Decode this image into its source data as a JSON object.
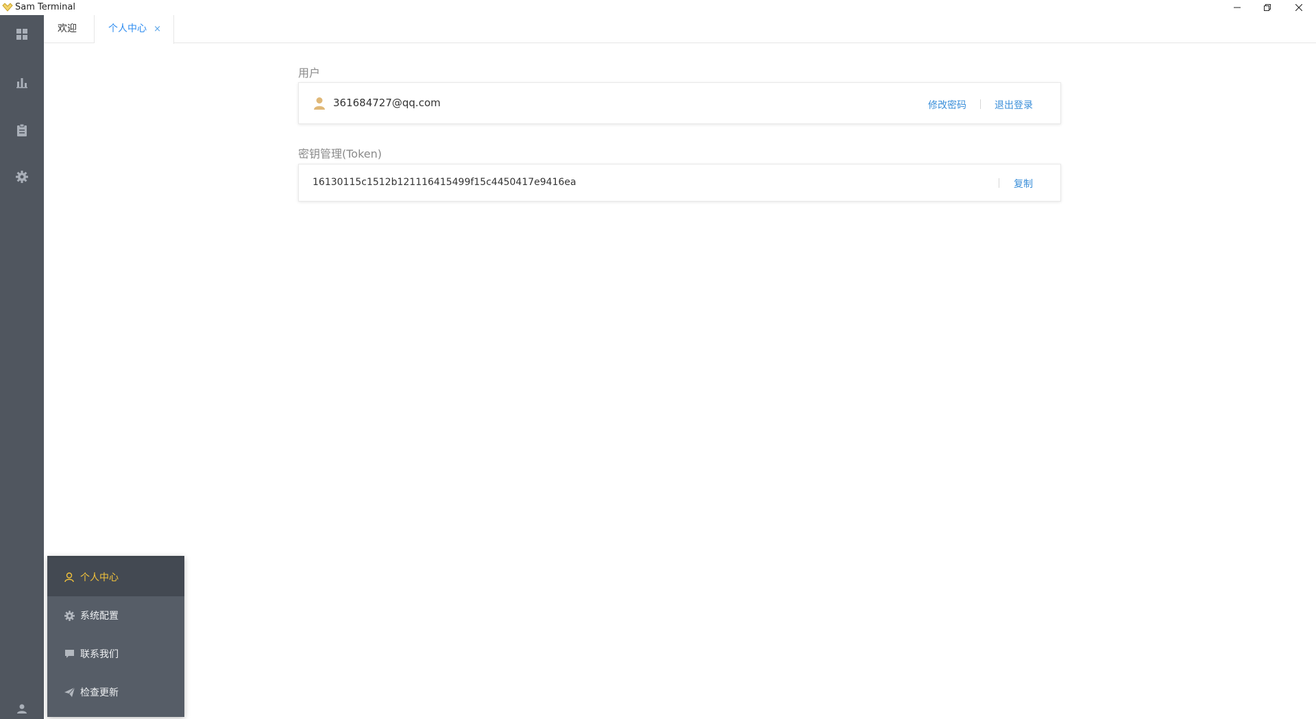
{
  "window": {
    "title": "Sam Terminal"
  },
  "tabs": {
    "welcome": "欢迎",
    "profile": "个人中心",
    "close_glyph": "×"
  },
  "user_section": {
    "label": "用户",
    "email": "361684727@qq.com",
    "change_password": "修改密码",
    "logout": "退出登录"
  },
  "token_section": {
    "label": "密钥管理(Token)",
    "token": "16130115c1512b121116415499f15c4450417e9416ea",
    "copy": "复制"
  },
  "popup_menu": {
    "items": [
      {
        "label": "个人中心",
        "icon": "user-icon",
        "active": true
      },
      {
        "label": "系统配置",
        "icon": "gear-icon",
        "active": false
      },
      {
        "label": "联系我们",
        "icon": "chat-icon",
        "active": false
      },
      {
        "label": "检查更新",
        "icon": "send-icon",
        "active": false
      }
    ]
  },
  "colors": {
    "sidebar": "#50565f",
    "link": "#3b8fd9",
    "active_menu": "#f3c33b"
  }
}
